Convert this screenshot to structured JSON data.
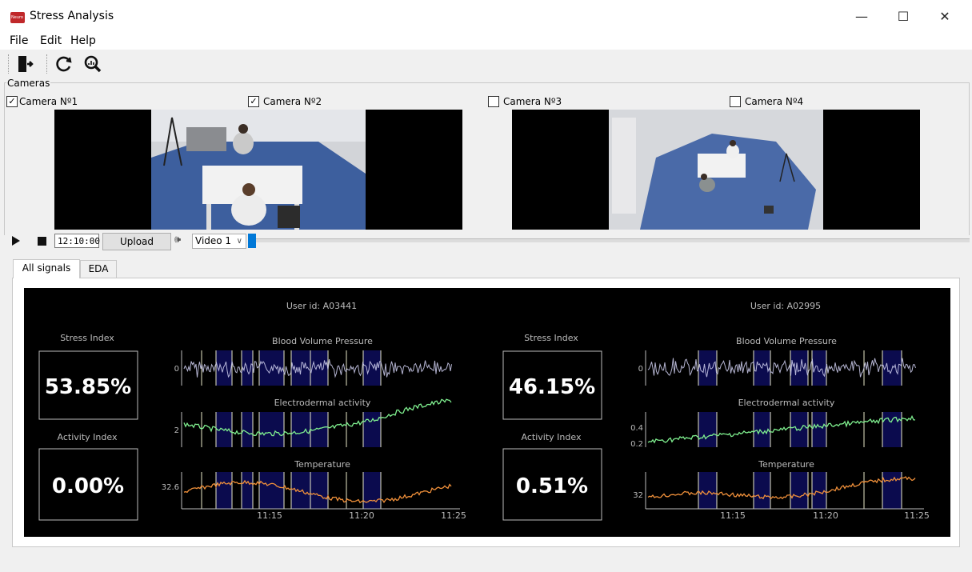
{
  "window": {
    "title": "Stress Analysis",
    "icon_text": "Neuro",
    "controls": [
      "—",
      "☐",
      "✕"
    ]
  },
  "menu": [
    "File",
    "Edit",
    "Help"
  ],
  "toolbar": [
    "exit-icon",
    "refresh-icon",
    "zoom-icon"
  ],
  "cameras": {
    "group_label": "Cameras",
    "items": [
      {
        "label": "Camera Nº1",
        "checked": true
      },
      {
        "label": "Camera Nº2",
        "checked": true
      },
      {
        "label": "Camera Nº3",
        "checked": false
      },
      {
        "label": "Camera Nº4",
        "checked": false
      }
    ]
  },
  "playback": {
    "time": "12:10:00",
    "upload_label": "Upload",
    "video_select": "Video 1",
    "speaker_icon": "🕪"
  },
  "tabs": [
    {
      "label": "All signals",
      "active": true
    },
    {
      "label": "EDA",
      "active": false
    }
  ],
  "users": [
    {
      "user_label": "User id: A03441",
      "stress_label": "Stress Index",
      "stress_value": "53.85%",
      "activity_label": "Activity Index",
      "activity_value": "0.00%",
      "bvp_title": "Blood Volume Pressure",
      "bvp_tick": "0",
      "eda_title": "Electrodermal activity",
      "eda_ticks": [
        "2"
      ],
      "temp_title": "Temperature",
      "temp_tick": "32.6",
      "time_ticks": [
        "11:15",
        "11:20",
        "11:25"
      ]
    },
    {
      "user_label": "User id: A02995",
      "stress_label": "Stress Index",
      "stress_value": "46.15%",
      "activity_label": "Activity Index",
      "activity_value": "0.51%",
      "bvp_title": "Blood Volume Pressure",
      "bvp_tick": "0",
      "eda_title": "Electrodermal activity",
      "eda_ticks": [
        "0.4",
        "0.2"
      ],
      "temp_title": "Temperature",
      "temp_tick": "32",
      "time_ticks": [
        "11:15",
        "11:20",
        "11:25"
      ]
    }
  ],
  "colors": {
    "accent": "#0078d7",
    "stress_band": "#0b0b4e",
    "eda_line": "#7ff08f",
    "temp_line": "#f0903a",
    "bvp_line": "#c8c8e8"
  }
}
